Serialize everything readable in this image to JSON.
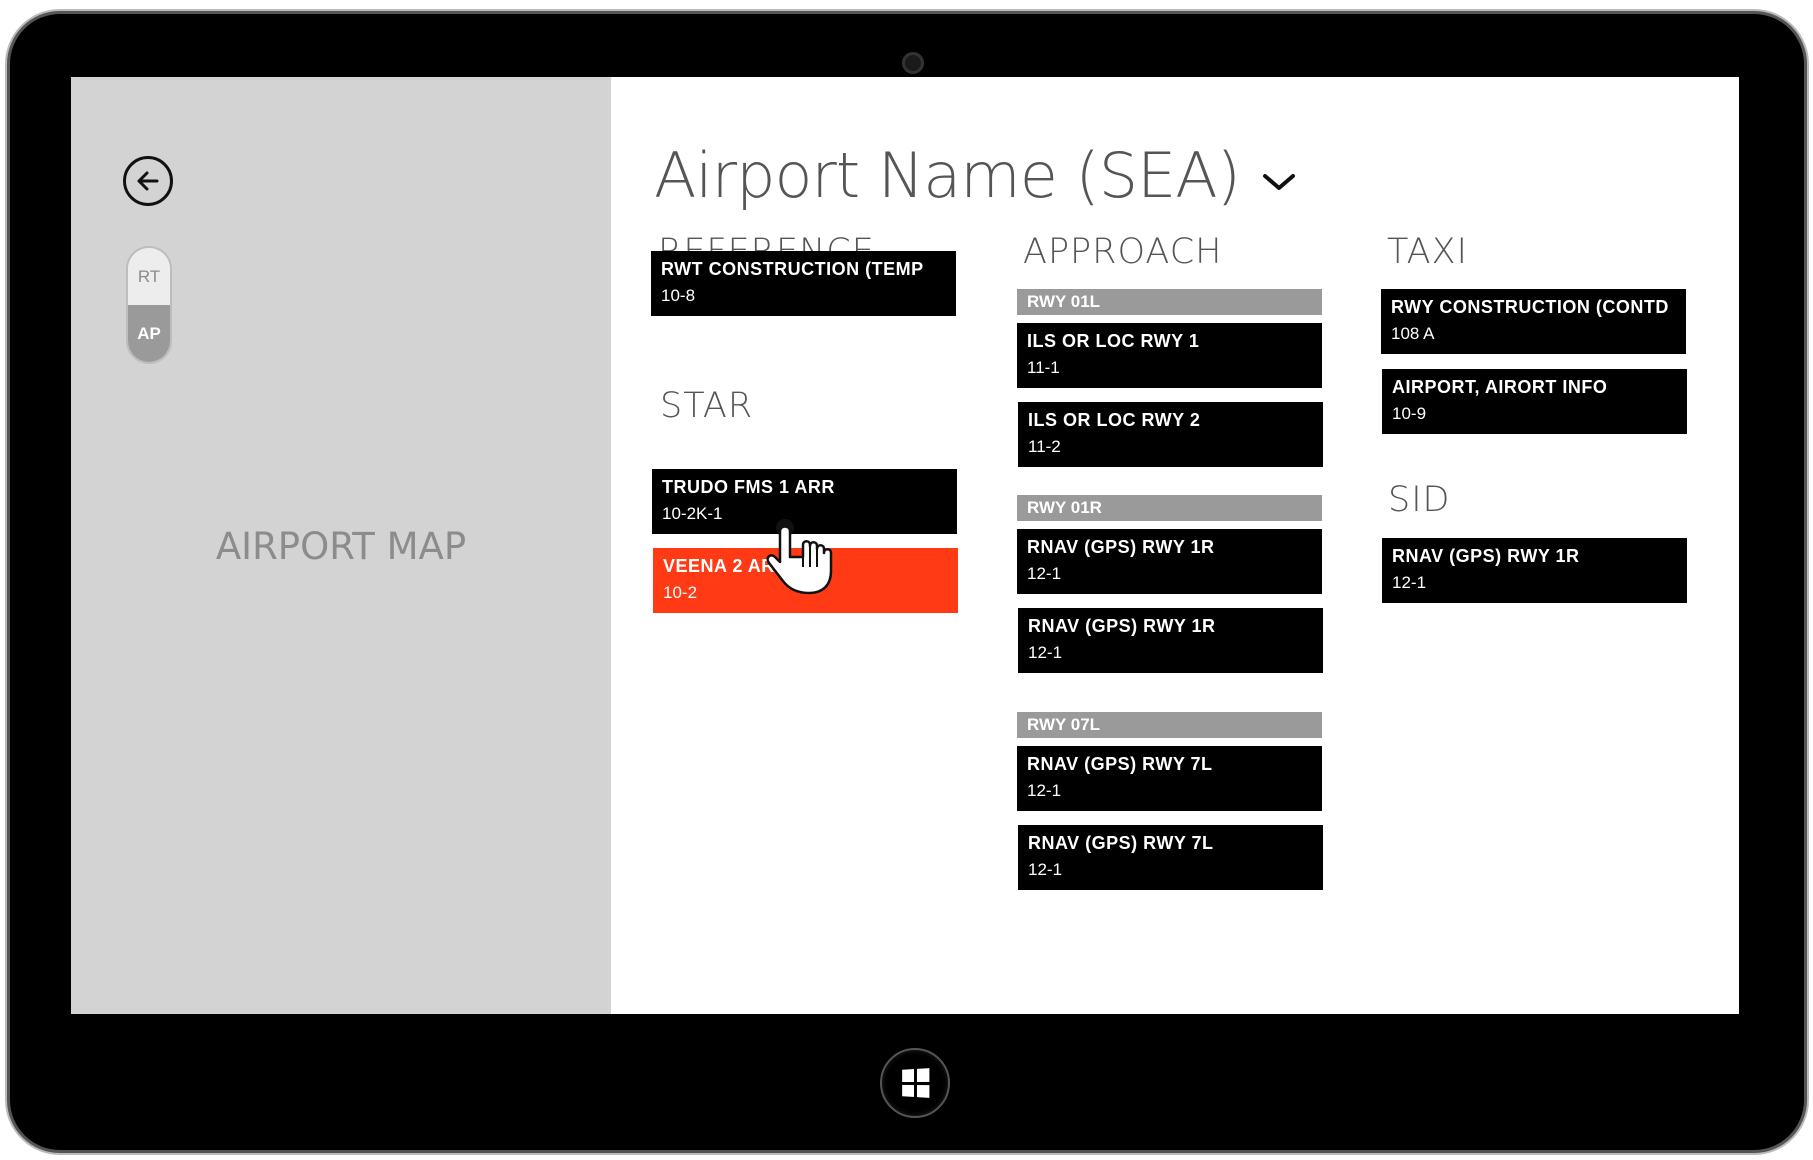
{
  "left_pane": {
    "back_icon": "back-arrow-circle-icon",
    "toggle": {
      "rt": "RT",
      "ap": "AP",
      "selected": "AP"
    },
    "map_label": "AIRPORT MAP"
  },
  "header": {
    "title": "Airport Name (SEA)",
    "dropdown_icon": "chevron-down-icon"
  },
  "sections": {
    "reference": {
      "heading": "REFERENCE",
      "tiles": [
        {
          "name": "RWT CONSTRUCTION (TEMP",
          "code": "10-8"
        }
      ]
    },
    "star": {
      "heading": "STAR",
      "tiles": [
        {
          "name": "TRUDO FMS 1 ARR",
          "code": "10-2K-1"
        },
        {
          "name": "VEENA 2 ARR",
          "code": "10-2",
          "active": true
        }
      ]
    },
    "approach": {
      "heading": "APPROACH",
      "groups": [
        {
          "runway": "RWY 01L",
          "tiles": [
            {
              "name": "ILS OR LOC RWY 1",
              "code": "11-1"
            },
            {
              "name": "ILS OR LOC RWY 2",
              "code": "11-2"
            }
          ]
        },
        {
          "runway": "RWY 01R",
          "tiles": [
            {
              "name": "RNAV (GPS) RWY 1R",
              "code": "12-1"
            },
            {
              "name": "RNAV (GPS) RWY 1R",
              "code": "12-1"
            }
          ]
        },
        {
          "runway": "RWY 07L",
          "tiles": [
            {
              "name": "RNAV (GPS) RWY 7L",
              "code": "12-1"
            },
            {
              "name": "RNAV (GPS) RWY 7L",
              "code": "12-1"
            }
          ]
        }
      ]
    },
    "taxi": {
      "heading": "TAXI",
      "tiles": [
        {
          "name": "RWY CONSTRUCTION (CONTD",
          "code": "108 A"
        },
        {
          "name": "AIRPORT, AIRORT INFO",
          "code": "10-9"
        }
      ]
    },
    "sid": {
      "heading": "SID",
      "tiles": [
        {
          "name": "RNAV (GPS) RWY 1R",
          "code": "12-1"
        }
      ]
    }
  },
  "colors": {
    "active_tile": "#ff3a14",
    "tile": "#000000",
    "runway_bar": "#9a9a9a",
    "left_pane": "#d3d3d3"
  },
  "device": {
    "home_button_icon": "windows-logo-icon",
    "camera_icon": "camera-icon",
    "pointer_icon": "hand-pointer-icon"
  }
}
